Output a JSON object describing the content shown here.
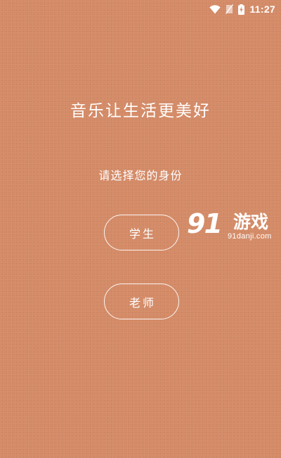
{
  "status_bar": {
    "time": "11:27",
    "icons": [
      "wifi-icon",
      "no-sim-icon",
      "battery-charging-icon"
    ]
  },
  "main": {
    "slogan": "音乐让生活更美好",
    "prompt": "请选择您的身份",
    "roles": [
      {
        "label": "学生"
      },
      {
        "label": "老师"
      }
    ]
  },
  "watermark": {
    "logo": "91",
    "name": "游戏",
    "url": "91danji.com"
  },
  "colors": {
    "background": "#d48a66",
    "text": "#ffffff",
    "button_border": "#ffffff"
  }
}
